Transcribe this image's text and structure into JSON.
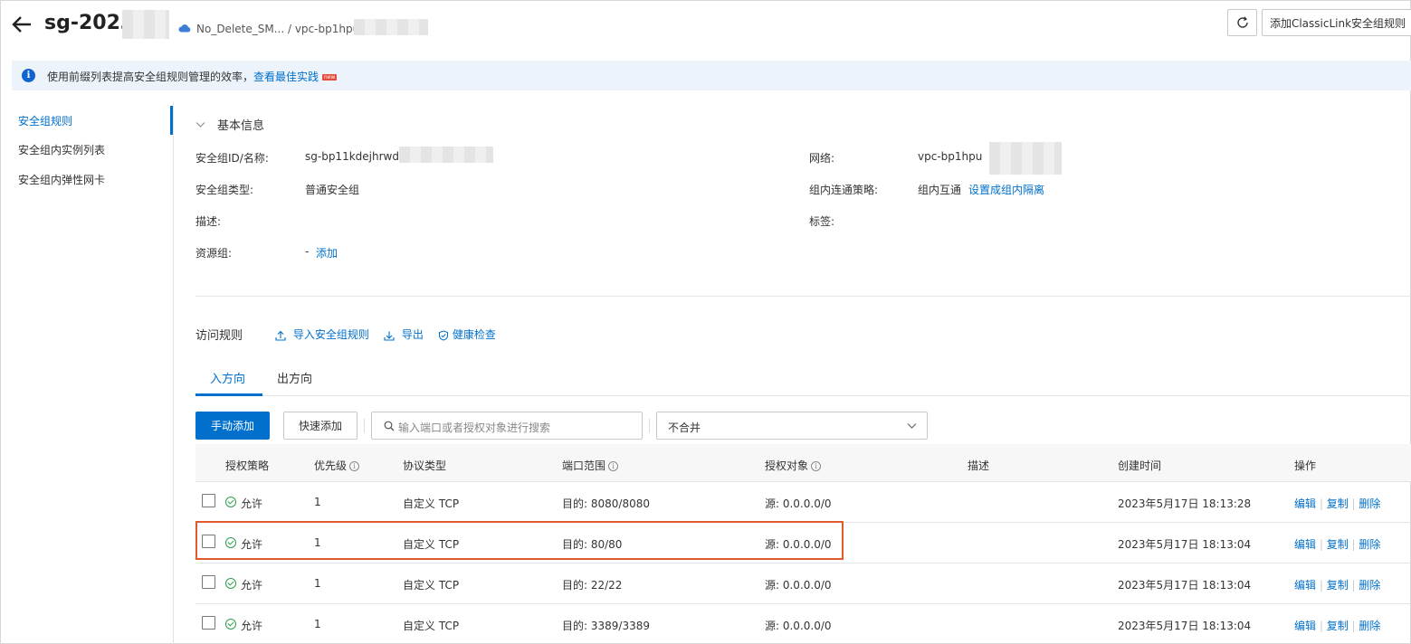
{
  "header": {
    "title": "sg-2023",
    "vpc_path": "No_Delete_SM... / vpc-bp1hpu2",
    "refresh_label": "",
    "add_classiclink_label": "添加ClassicLink安全组规则"
  },
  "notice": {
    "text": "使用前缀列表提高安全组规则管理的效率，",
    "link": "查看最佳实践",
    "badge": "new"
  },
  "sidebar": {
    "items": [
      {
        "label": "安全组规则"
      },
      {
        "label": "安全组内实例列表"
      },
      {
        "label": "安全组内弹性网卡"
      }
    ]
  },
  "basic_info": {
    "section_title": "基本信息",
    "id_label": "安全组ID/名称:",
    "id_value": "sg-bp11kdejhrwdib",
    "type_label": "安全组类型:",
    "type_value": "普通安全组",
    "desc_label": "描述:",
    "rg_label": "资源组:",
    "rg_value": "-",
    "rg_add": "添加",
    "network_label": "网络:",
    "network_value": "vpc-bp1hpu",
    "policy_label": "组内连通策略:",
    "policy_value": "组内互通",
    "policy_link": "设置成组内隔离",
    "tags_label": "标签:"
  },
  "rules": {
    "title": "访问规则",
    "import_label": "导入安全组规则",
    "export_label": "导出",
    "health_label": "健康检查",
    "tabs": [
      {
        "label": "入方向"
      },
      {
        "label": "出方向"
      }
    ],
    "manual_add": "手动添加",
    "quick_add": "快速添加",
    "search_placeholder": "输入端口或者授权对象进行搜索",
    "merge_select": "不合并",
    "columns": [
      "授权策略",
      "优先级",
      "协议类型",
      "端口范围",
      "授权对象",
      "描述",
      "创建时间",
      "操作"
    ],
    "rows": [
      {
        "policy": "允许",
        "priority": "1",
        "protocol": "自定义 TCP",
        "port": "目的: 8080/8080",
        "source": "源: 0.0.0.0/0",
        "created": "2023年5月17日 18:13:28",
        "edit": "编辑",
        "copy": "复制",
        "delete": "删除"
      },
      {
        "policy": "允许",
        "priority": "1",
        "protocol": "自定义 TCP",
        "port": "目的: 80/80",
        "source": "源: 0.0.0.0/0",
        "created": "2023年5月17日 18:13:04",
        "edit": "编辑",
        "copy": "复制",
        "delete": "删除"
      },
      {
        "policy": "允许",
        "priority": "1",
        "protocol": "自定义 TCP",
        "port": "目的: 22/22",
        "source": "源: 0.0.0.0/0",
        "created": "2023年5月17日 18:13:04",
        "edit": "编辑",
        "copy": "复制",
        "delete": "删除"
      },
      {
        "policy": "允许",
        "priority": "1",
        "protocol": "自定义 TCP",
        "port": "目的: 3389/3389",
        "source": "源: 0.0.0.0/0",
        "created": "2023年5月17日 18:13:04",
        "edit": "编辑",
        "copy": "复制",
        "delete": "删除"
      }
    ]
  },
  "colors": {
    "accent": "#0070cc",
    "highlight_box": "#e05a2b",
    "allow_green": "#2d9e4e"
  }
}
